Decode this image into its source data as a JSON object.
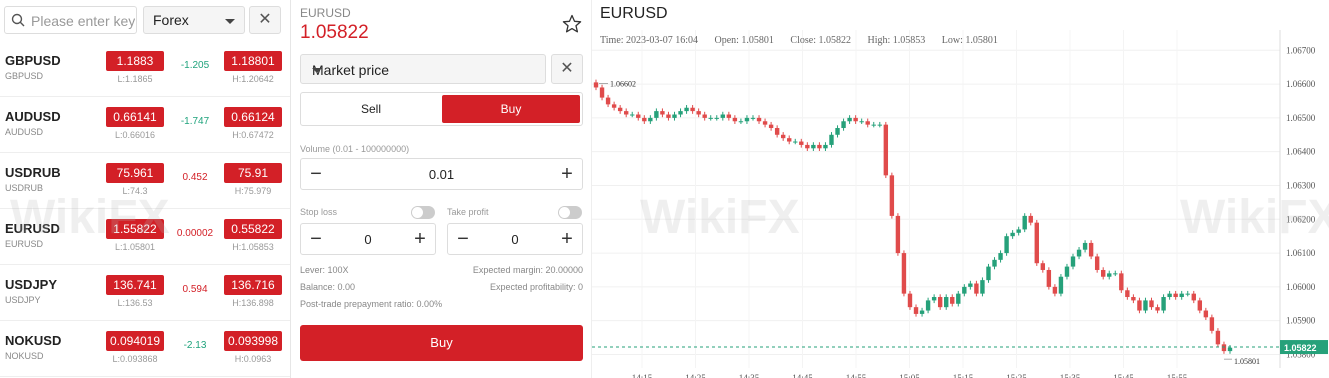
{
  "search": {
    "placeholder": "Please enter key"
  },
  "category": {
    "selected": "Forex"
  },
  "close_glyph": "✕",
  "quotes": [
    {
      "symbol": "GBPUSD",
      "sub": "GBPUSD",
      "bid": "1.1883",
      "ask": "1.18801",
      "change": "-1.205",
      "dir": "up",
      "low": "L:1.1865",
      "high": "H:1.20642"
    },
    {
      "symbol": "AUDUSD",
      "sub": "AUDUSD",
      "bid": "0.66141",
      "ask": "0.66124",
      "change": "-1.747",
      "dir": "up",
      "low": "L:0.66016",
      "high": "H:0.67472"
    },
    {
      "symbol": "USDRUB",
      "sub": "USDRUB",
      "bid": "75.961",
      "ask": "75.91",
      "change": "0.452",
      "dir": "dn",
      "low": "L:74.3",
      "high": "H:75.979"
    },
    {
      "symbol": "EURUSD",
      "sub": "EURUSD",
      "bid": "1.55822",
      "ask": "0.55822",
      "change": "0.00002",
      "dir": "dn",
      "low": "L:1.05801",
      "high": "H:1.05853"
    },
    {
      "symbol": "USDJPY",
      "sub": "USDJPY",
      "bid": "136.741",
      "ask": "136.716",
      "change": "0.594",
      "dir": "dn",
      "low": "L:136.53",
      "high": "H:136.898"
    },
    {
      "symbol": "NOKUSD",
      "sub": "NOKUSD",
      "bid": "0.094019",
      "ask": "0.093998",
      "change": "-2.13",
      "dir": "up",
      "low": "L:0.093868",
      "high": "H:0.0963"
    }
  ],
  "trade": {
    "symbol": "EURUSD",
    "price": "1.05822",
    "order_type": "Market price",
    "sell_label": "Sell",
    "buy_label": "Buy",
    "volume_label": "Volume  (0.01 - 100000000)",
    "volume_value": "0.01",
    "stop_loss_label": "Stop loss",
    "take_profit_label": "Take profit",
    "stop_loss_value": "0",
    "take_profit_value": "0",
    "lever": "Lever:  100X",
    "expected_margin": "Expected margin:  20.00000",
    "balance": "Balance:  0.00",
    "expected_profitability": "Expected profitability:  0",
    "post_trade": "Post-trade prepayment ratio:  0.00%",
    "submit_label": "Buy"
  },
  "chart_header": {
    "title": "EURUSD",
    "time": "Time: 2023-03-07 16:04",
    "open": "Open: 1.05801",
    "close": "Close: 1.05822",
    "high": "High: 1.05853",
    "low": "Low: 1.05801"
  },
  "watermark": "WikiFX",
  "chart_data": {
    "type": "candlestick",
    "title": "EURUSD",
    "x_ticks": [
      "14:15",
      "14:25",
      "14:35",
      "14:45",
      "14:55",
      "15:05",
      "15:15",
      "15:25",
      "15:35",
      "15:45",
      "15:55"
    ],
    "y_ticks": [
      "1.06700",
      "1.06600",
      "1.06500",
      "1.06400",
      "1.06300",
      "1.06200",
      "1.06100",
      "1.06000",
      "1.05900",
      "1.05800"
    ],
    "ylim": [
      1.0576,
      1.0676
    ],
    "last_price": "1.05822",
    "max_label": "1.06602",
    "min_label": "1.05801",
    "colors": {
      "up": "#26a17a",
      "down": "#e04b4b",
      "last": "#26a17a"
    },
    "closes": [
      1.0659,
      1.0656,
      1.0654,
      1.0653,
      1.0652,
      1.0651,
      1.0651,
      1.065,
      1.0649,
      1.065,
      1.0652,
      1.0651,
      1.065,
      1.0651,
      1.0652,
      1.0653,
      1.0652,
      1.0651,
      1.065,
      1.065,
      1.065,
      1.0651,
      1.065,
      1.0649,
      1.0649,
      1.065,
      1.065,
      1.0649,
      1.0648,
      1.0647,
      1.0645,
      1.0644,
      1.0643,
      1.0643,
      1.0642,
      1.0641,
      1.0642,
      1.0641,
      1.0642,
      1.0645,
      1.0647,
      1.0649,
      1.065,
      1.0649,
      1.0649,
      1.0648,
      1.0648,
      1.0648,
      1.0633,
      1.0621,
      1.061,
      1.0598,
      1.0594,
      1.0592,
      1.0593,
      1.0596,
      1.0597,
      1.0594,
      1.0597,
      1.0595,
      1.0598,
      1.06,
      1.0601,
      1.0598,
      1.0602,
      1.0606,
      1.0608,
      1.061,
      1.0615,
      1.0616,
      1.0617,
      1.0621,
      1.0619,
      1.0607,
      1.0605,
      1.06,
      1.0598,
      1.0603,
      1.0606,
      1.0609,
      1.0611,
      1.0613,
      1.0609,
      1.0605,
      1.0603,
      1.0604,
      1.0604,
      1.0599,
      1.0597,
      1.0596,
      1.0593,
      1.0596,
      1.0594,
      1.0593,
      1.0597,
      1.0598,
      1.0597,
      1.0598,
      1.0598,
      1.0596,
      1.0593,
      1.0591,
      1.0587,
      1.0583,
      1.0581,
      1.0582
    ]
  }
}
